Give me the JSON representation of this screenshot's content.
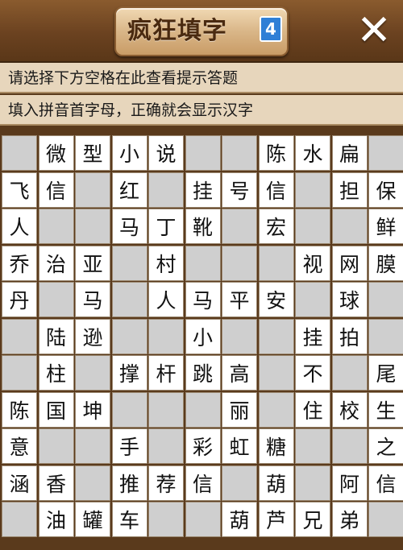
{
  "header": {
    "title": "疯狂填字",
    "badge": "4",
    "close_label": "✕"
  },
  "hints": {
    "line1": "请选择下方空格在此查看提示答题",
    "line2": "填入拼音首字母，正确就会显示汉字"
  },
  "grid": {
    "rows": [
      [
        "",
        "微",
        "型",
        "小",
        "说",
        "",
        "",
        "陈",
        "水",
        "扁",
        ""
      ],
      [
        "飞",
        "信",
        "",
        "红",
        "",
        "挂",
        "号",
        "信",
        "",
        "担",
        "保"
      ],
      [
        "人",
        "",
        "",
        "马",
        "丁",
        "靴",
        "",
        "宏",
        "",
        "",
        "鲜"
      ],
      [
        "乔",
        "治",
        "亚",
        "",
        "村",
        "",
        "",
        "",
        "视",
        "网",
        "膜"
      ],
      [
        "丹",
        "",
        "马",
        "",
        "人",
        "马",
        "平",
        "安",
        "",
        "球",
        ""
      ],
      [
        "",
        "陆",
        "逊",
        "",
        "",
        "小",
        "",
        "",
        "挂",
        "拍",
        ""
      ],
      [
        "",
        "柱",
        "",
        "撑",
        "杆",
        "跳",
        "高",
        "",
        "不",
        "",
        "尾"
      ],
      [
        "陈",
        "国",
        "坤",
        "",
        "",
        "",
        "丽",
        "",
        "住",
        "校",
        "生"
      ],
      [
        "意",
        "",
        "",
        "手",
        "",
        "彩",
        "虹",
        "糖",
        "",
        "",
        "之"
      ],
      [
        "涵",
        "香",
        "",
        "推",
        "荐",
        "信",
        "",
        "葫",
        "",
        "阿",
        "信"
      ],
      [
        "",
        "油",
        "罐",
        "车",
        "",
        "",
        "葫",
        "芦",
        "兄",
        "弟",
        ""
      ]
    ],
    "fill_mask": [
      [
        0,
        1,
        1,
        1,
        1,
        0,
        0,
        1,
        1,
        1,
        0
      ],
      [
        1,
        1,
        0,
        1,
        0,
        1,
        1,
        1,
        0,
        1,
        1
      ],
      [
        1,
        0,
        0,
        1,
        1,
        1,
        0,
        1,
        0,
        0,
        1
      ],
      [
        1,
        1,
        1,
        0,
        1,
        0,
        0,
        0,
        1,
        1,
        1
      ],
      [
        1,
        0,
        1,
        0,
        1,
        1,
        1,
        1,
        0,
        1,
        0
      ],
      [
        0,
        1,
        1,
        0,
        0,
        1,
        0,
        0,
        1,
        1,
        0
      ],
      [
        0,
        1,
        0,
        1,
        1,
        1,
        1,
        0,
        1,
        0,
        1
      ],
      [
        1,
        1,
        1,
        0,
        0,
        0,
        1,
        0,
        1,
        1,
        1
      ],
      [
        1,
        0,
        0,
        1,
        0,
        1,
        1,
        1,
        0,
        0,
        1
      ],
      [
        1,
        1,
        0,
        1,
        1,
        1,
        0,
        1,
        0,
        1,
        1
      ],
      [
        0,
        1,
        1,
        1,
        0,
        0,
        1,
        1,
        1,
        1,
        0
      ]
    ]
  },
  "colors": {
    "wood": "#5a3a1c",
    "hint_bg": "#e7d6bc",
    "cell_filled": "#ffffff",
    "cell_blank": "#d1d1d1"
  }
}
